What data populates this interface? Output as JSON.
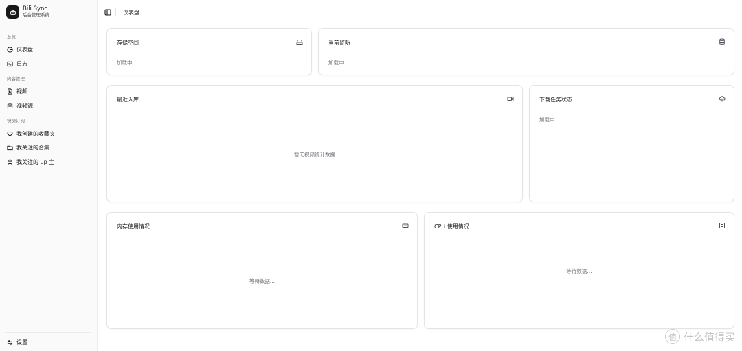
{
  "app": {
    "name": "Bili Sync",
    "subtitle": "后台管理系统"
  },
  "sidebar": {
    "sections": [
      {
        "label": "总览",
        "items": [
          {
            "label": "仪表盘",
            "icon": "dashboard-icon"
          },
          {
            "label": "日志",
            "icon": "terminal-icon"
          }
        ]
      },
      {
        "label": "内容管理",
        "items": [
          {
            "label": "视频",
            "icon": "file-video-icon"
          },
          {
            "label": "视频源",
            "icon": "database-icon"
          }
        ]
      },
      {
        "label": "快捷订阅",
        "items": [
          {
            "label": "我创建的收藏夹",
            "icon": "heart-icon"
          },
          {
            "label": "我关注的合集",
            "icon": "folder-icon"
          },
          {
            "label": "我关注的 up 主",
            "icon": "user-icon"
          }
        ]
      }
    ],
    "footer": {
      "label": "设置",
      "icon": "sliders-icon"
    }
  },
  "header": {
    "breadcrumb": "仪表盘"
  },
  "cards": {
    "storage": {
      "title": "存储空间",
      "status": "加载中...",
      "icon": "hard-drive-icon"
    },
    "monitor": {
      "title": "当前监听",
      "status": "加载中...",
      "icon": "database-icon"
    },
    "recent": {
      "title": "最近入库",
      "empty": "暂无视频统计数据",
      "icon": "video-icon"
    },
    "tasks": {
      "title": "下载任务状态",
      "status": "加载中...",
      "icon": "cloud-download-icon"
    },
    "memory": {
      "title": "内存使用情况",
      "empty": "等待数据...",
      "icon": "memory-stick-icon"
    },
    "cpu": {
      "title": "CPU 使用情况",
      "empty": "等待数据...",
      "icon": "cpu-icon"
    }
  },
  "watermark": {
    "text": "什么值得买",
    "logo_glyph": "值"
  }
}
